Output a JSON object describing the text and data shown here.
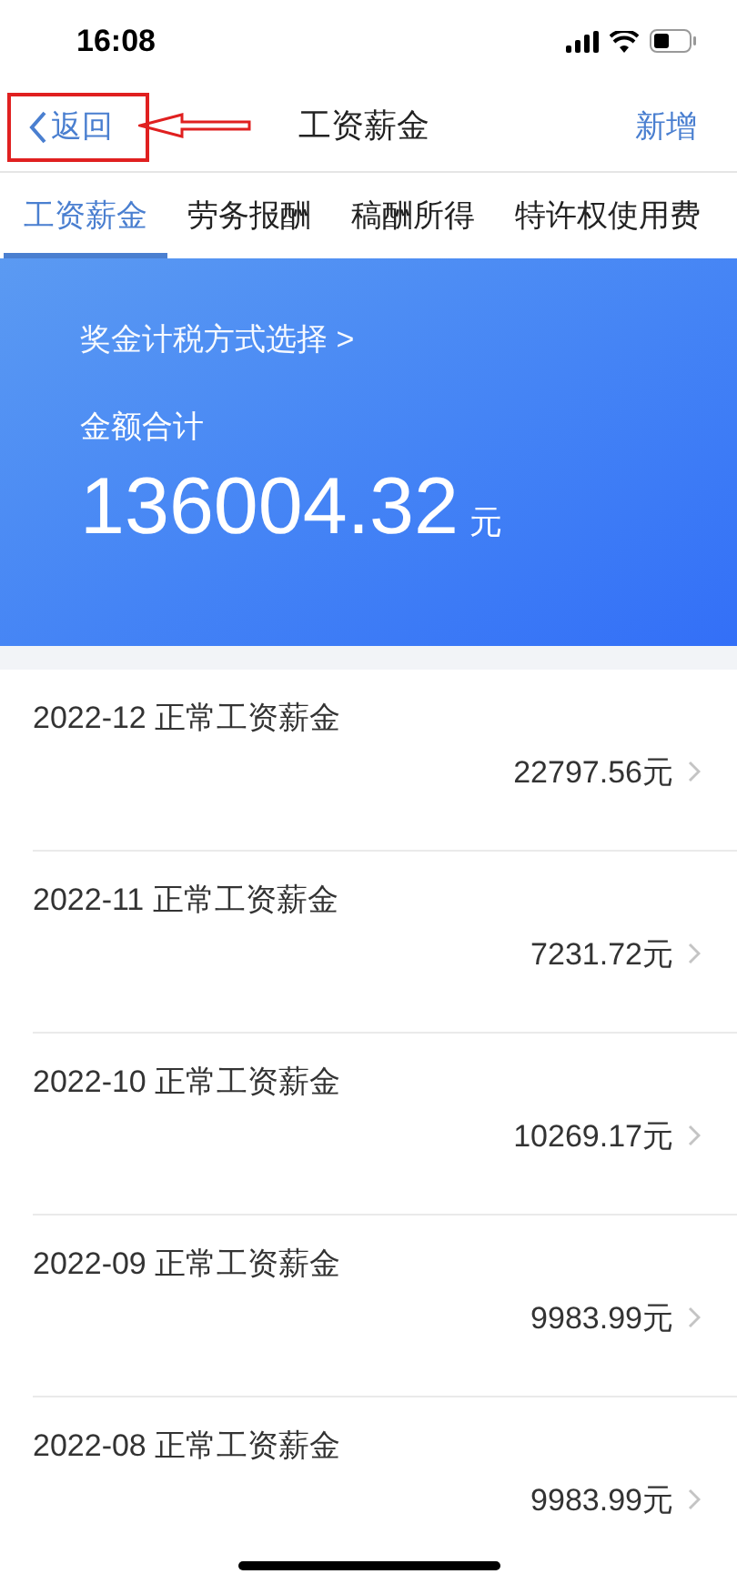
{
  "status_bar": {
    "time": "16:08"
  },
  "nav": {
    "back": "返回",
    "title": "工资薪金",
    "action": "新增",
    "back_highlighted": true
  },
  "tabs": [
    {
      "label": "工资薪金",
      "selected": true
    },
    {
      "label": "劳务报酬",
      "selected": false
    },
    {
      "label": "稿酬所得",
      "selected": false
    },
    {
      "label": "特许权使用费",
      "selected": false
    }
  ],
  "summary": {
    "link": "奖金计税方式选择 >",
    "label": "金额合计",
    "amount": "136004.32",
    "unit": "元"
  },
  "rows": [
    {
      "title": "2022-12 正常工资薪金",
      "amount": "22797.56元"
    },
    {
      "title": "2022-11 正常工资薪金",
      "amount": "7231.72元"
    },
    {
      "title": "2022-10 正常工资薪金",
      "amount": "10269.17元"
    },
    {
      "title": "2022-09 正常工资薪金",
      "amount": "9983.99元"
    },
    {
      "title": "2022-08 正常工资薪金",
      "amount": "9983.99元"
    }
  ]
}
